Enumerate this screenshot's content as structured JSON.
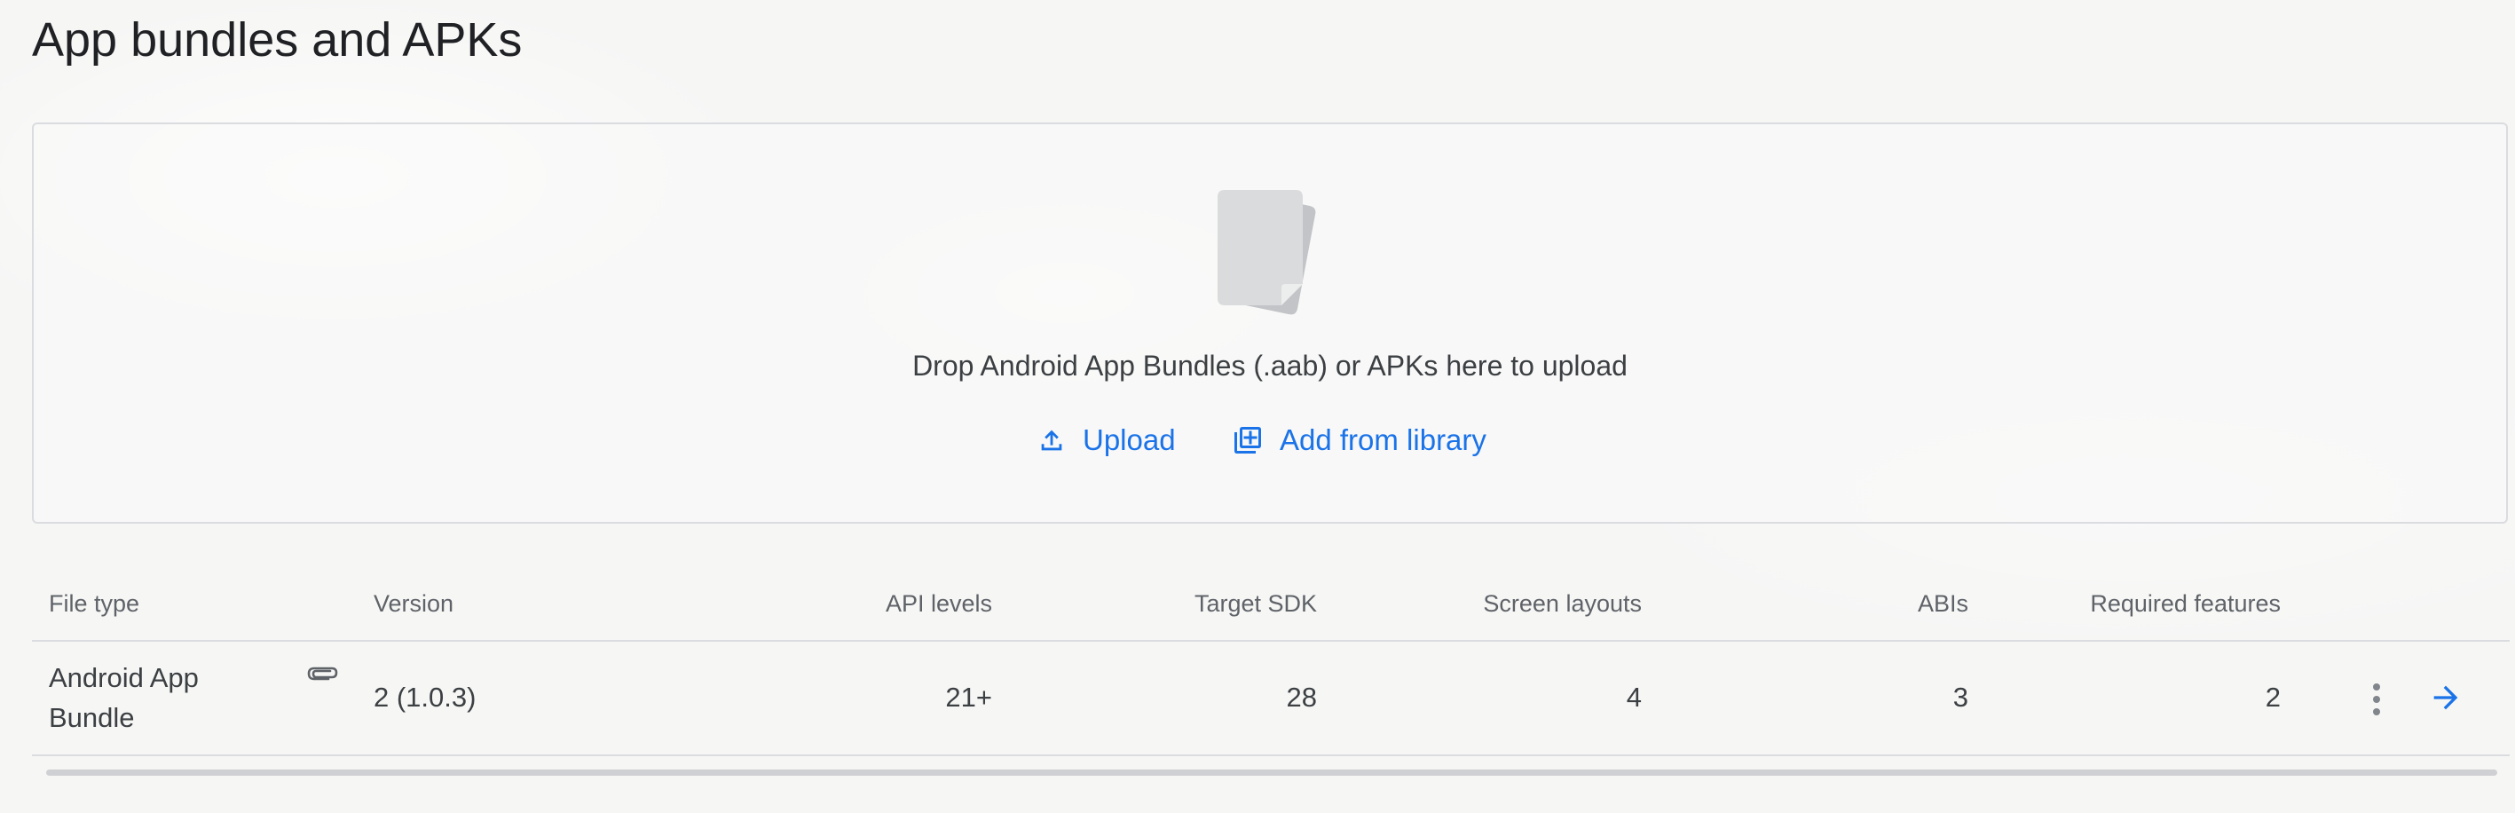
{
  "page": {
    "title": "App bundles and APKs"
  },
  "dropzone": {
    "text": "Drop Android App Bundles (.aab) or APKs here to upload",
    "upload_label": "Upload",
    "library_label": "Add from library"
  },
  "table": {
    "columns": [
      "File type",
      "Version",
      "API levels",
      "Target SDK",
      "Screen layouts",
      "ABIs",
      "Required features"
    ],
    "rows": [
      {
        "file_type_line1": "Android App",
        "file_type_line2": "Bundle",
        "version": "2 (1.0.3)",
        "api_levels": "21+",
        "target_sdk": "28",
        "screen_layouts": "4",
        "abis": "3",
        "required_features": "2"
      }
    ]
  },
  "icons": {
    "upload": "upload-icon",
    "library": "add-to-library-icon",
    "attachment": "paperclip-icon",
    "more": "more-vert-icon",
    "details": "arrow-forward-icon"
  },
  "colors": {
    "accent": "#1a73e8",
    "text": "#202124",
    "muted": "#5f6368",
    "border": "#dadce0"
  }
}
